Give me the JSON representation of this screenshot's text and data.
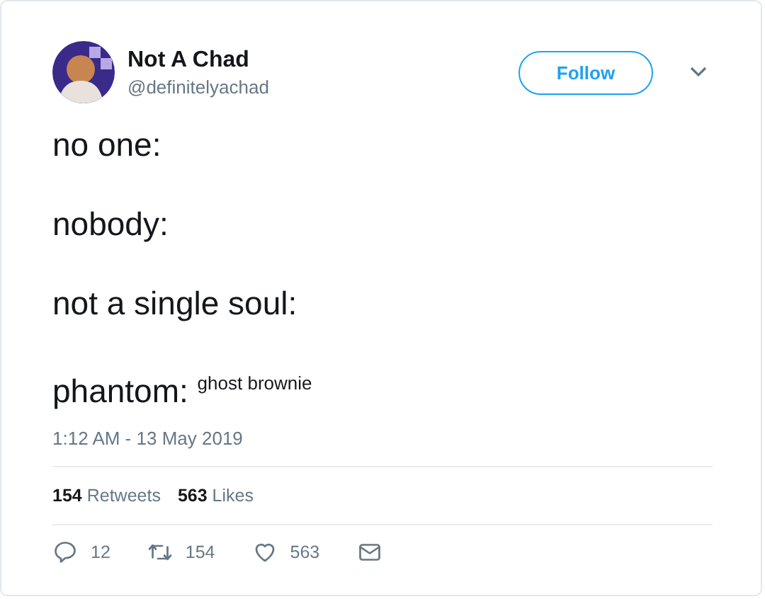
{
  "author": {
    "name": "Not A Chad",
    "handle": "@definitelyachad"
  },
  "follow_button": "Follow",
  "lines": [
    "no one:",
    "nobody:",
    "not a single soul:",
    "phantom: $^{ghost brownie}$"
  ],
  "timestamp": "1:12 AM - 13 May 2019",
  "stats": [
    {
      "count": "154",
      "label": "Retweets"
    },
    {
      "count": "563",
      "label": "Likes"
    }
  ],
  "actions": [
    {
      "kind": "reply",
      "count": "12"
    },
    {
      "kind": "retweet",
      "count": "154"
    },
    {
      "kind": "like",
      "count": "563"
    },
    {
      "kind": "message"
    }
  ]
}
